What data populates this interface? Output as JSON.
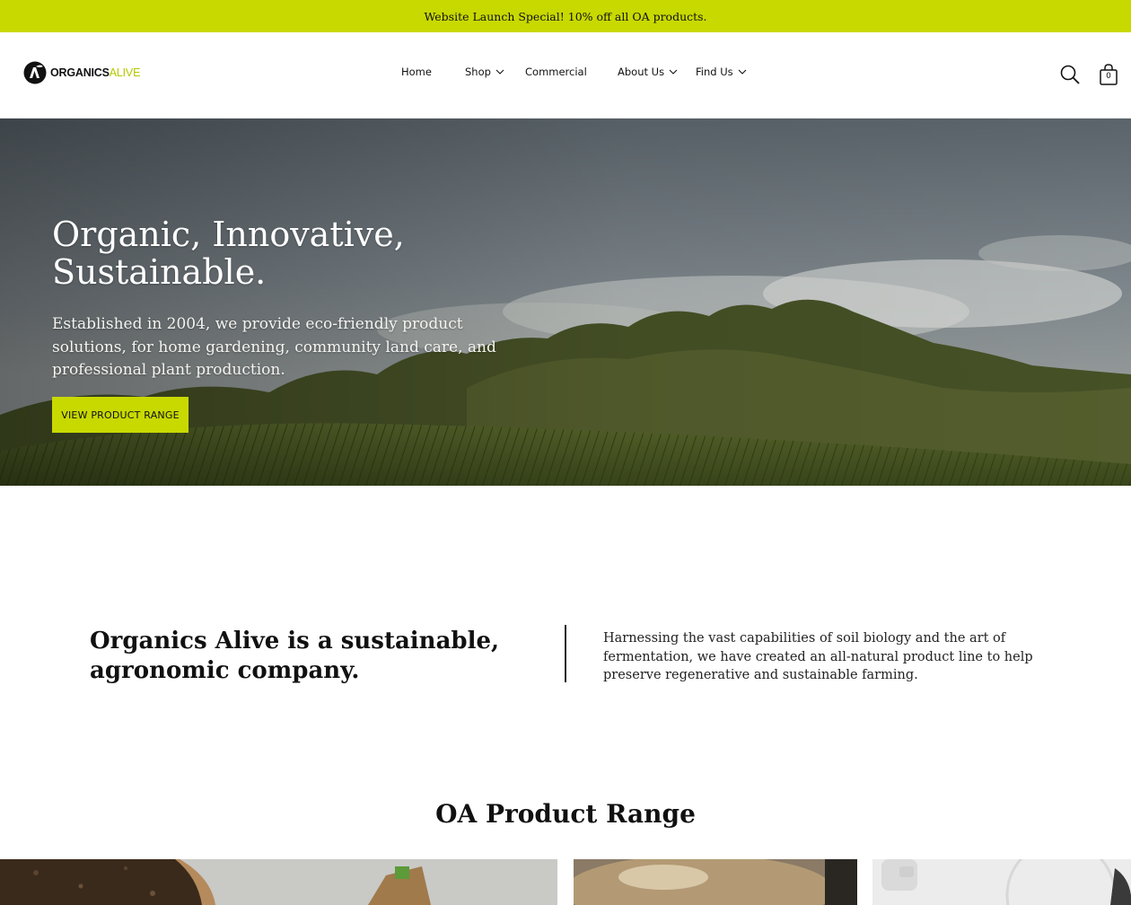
{
  "announcement": {
    "text": "Website Launch Special! 10% off all OA products."
  },
  "brand": {
    "logo_primary": "ORGANICS",
    "logo_accent": "ALIVE",
    "accent_color": "#c8d900"
  },
  "nav": {
    "home": "Home",
    "shop": "Shop",
    "commercial": "Commercial",
    "about": "About Us",
    "find": "Find Us"
  },
  "header_icons": {
    "search": "search-icon",
    "cart": "shopping-bag-icon",
    "cart_count": "0"
  },
  "hero": {
    "title": "Organic, Innovative, Sustainable.",
    "subtitle": "Established in 2004, we provide eco-friendly product solutions, for home gardening, community land care, and professional plant production.",
    "cta": "VIEW PRODUCT RANGE"
  },
  "about": {
    "heading": "Organics Alive is a sustainable, agronomic company.",
    "body": "Harnessing the vast capabilities of soil biology and the art of fermentation, we have created an all-natural product line to help preserve regenerative and sustainable farming."
  },
  "product_range": {
    "title": "OA Product Range"
  }
}
